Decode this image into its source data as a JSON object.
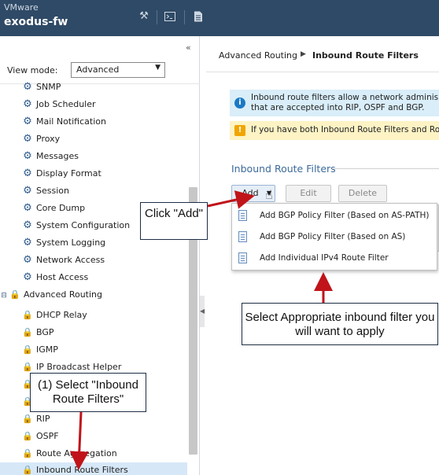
{
  "header": {
    "brand": "VMware",
    "title": "exodus-fw",
    "icons": [
      "wrench-icon",
      "terminal-icon",
      "document-icon"
    ]
  },
  "left_panel": {
    "collapse_glyph": "«",
    "view_mode_label": "View mode:",
    "view_mode_value": "Advanced",
    "items": [
      {
        "label": "SNMP",
        "icon": "gear-icon"
      },
      {
        "label": "Job Scheduler",
        "icon": "gear-icon"
      },
      {
        "label": "Mail Notification",
        "icon": "gear-icon"
      },
      {
        "label": "Proxy",
        "icon": "gear-icon"
      },
      {
        "label": "Messages",
        "icon": "gear-icon"
      },
      {
        "label": "Display Format",
        "icon": "gear-icon"
      },
      {
        "label": "Session",
        "icon": "gear-icon"
      },
      {
        "label": "Core Dump",
        "icon": "gear-icon"
      },
      {
        "label": "System Configuration",
        "icon": "gear-icon"
      },
      {
        "label": "System Logging",
        "icon": "gear-icon"
      },
      {
        "label": "Network Access",
        "icon": "gear-icon"
      },
      {
        "label": "Host Access",
        "icon": "gear-icon"
      },
      {
        "label": "Advanced Routing",
        "icon": "routing-icon"
      },
      {
        "label": "DHCP Relay",
        "icon": "routing-icon"
      },
      {
        "label": "BGP",
        "icon": "routing-icon"
      },
      {
        "label": "IGMP",
        "icon": "routing-icon"
      },
      {
        "label": "IP Broadcast Helper",
        "icon": "routing-icon"
      },
      {
        "label": "RIP",
        "icon": "routing-icon"
      },
      {
        "label": "OSPF",
        "icon": "routing-icon"
      },
      {
        "label": "Route Aggregation",
        "icon": "routing-icon"
      },
      {
        "label": "Inbound Route Filters",
        "icon": "routing-icon"
      }
    ]
  },
  "breadcrumb": {
    "root": "Advanced Routing",
    "current": "Inbound Route Filters"
  },
  "banners": {
    "info_line1": "Inbound route filters allow a network adminis",
    "info_line2": "that are accepted into RIP, OSPF and BGP.",
    "warning": "If you have both Inbound Route Filters and Ro"
  },
  "section": {
    "title": "Inbound Route Filters"
  },
  "toolbar": {
    "add_label": "Add",
    "edit_label": "Edit",
    "delete_label": "Delete"
  },
  "add_menu": [
    {
      "label": "Add BGP Policy Filter (Based on AS-PATH)"
    },
    {
      "label": "Add BGP Policy Filter (Based on AS)"
    },
    {
      "label": "Add Individual IPv4 Route Filter"
    }
  ],
  "annotations": {
    "click_add": "Click \"Add\"",
    "select_filter": "Select Appropriate inbound filter you will want to apply",
    "select_inbound": "(1) Select \"Inbound Route Filters\""
  },
  "colors": {
    "header_bg": "#2f4a66",
    "accent": "#3b6a9a",
    "selected_row": "#d6e8f8",
    "info_bg": "#d9eef9",
    "warning_bg": "#fdf3c4",
    "arrow": "#c0141a"
  }
}
